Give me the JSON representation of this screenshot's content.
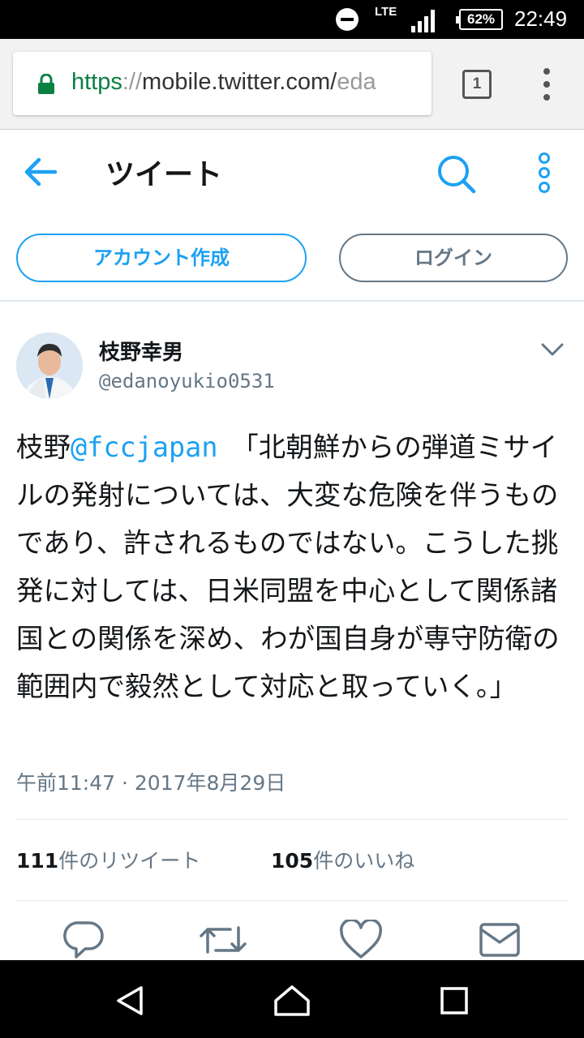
{
  "status_bar": {
    "network": "LTE",
    "battery": "62%",
    "time": "22:49"
  },
  "browser": {
    "url_scheme": "https",
    "url_sep": "://",
    "url_host": "mobile.twitter.com/",
    "url_rest": "eda",
    "tab_count": "1"
  },
  "header": {
    "title": "ツイート"
  },
  "auth": {
    "signup_label": "アカウント作成",
    "login_label": "ログイン"
  },
  "tweet": {
    "author_name": "枝野幸男",
    "author_handle": "@edanoyukio0531",
    "text_prefix": "枝野",
    "mention": "@fccjapan",
    "text_body": "　「北朝鮮からの弾道ミサイルの発射については、大変な危険を伴うものであり、許されるものではない。こうした挑発に対しては、日米同盟を中心として関係諸国との関係を深め、わが国自身が専守防衛の範囲内で毅然として対応と取っていく。」",
    "timestamp": "午前11:47 · 2017年8月29日",
    "retweet_count": "111",
    "retweet_label": "件のリツイート",
    "like_count": "105",
    "like_label": "件のいいね"
  },
  "colors": {
    "accent": "#1da1f2",
    "secondary_text": "#657786",
    "url_secure": "#0b8043"
  },
  "icons": [
    "dnd-icon",
    "signal-icon",
    "battery-icon",
    "lock-icon",
    "tabs-icon",
    "overflow-menu-icon",
    "back-arrow-icon",
    "search-icon",
    "kebab-menu-icon",
    "chevron-down-icon",
    "reply-icon",
    "retweet-icon",
    "like-icon",
    "message-icon",
    "nav-back-icon",
    "nav-home-icon",
    "nav-recents-icon"
  ]
}
